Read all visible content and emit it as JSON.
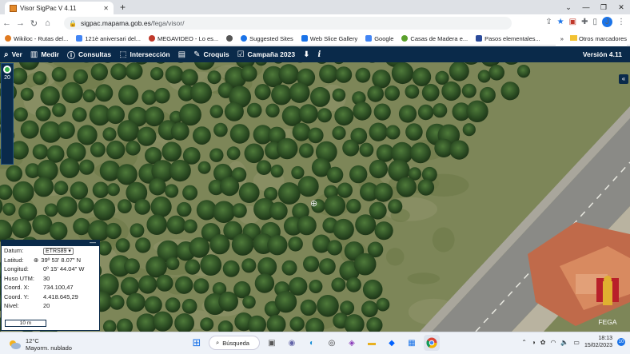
{
  "browser": {
    "tab_title": "Visor SigPac V 4.11",
    "tab_close": "✕",
    "new_tab": "+",
    "window_controls": [
      "⌄",
      "—",
      "❐",
      "✕"
    ],
    "url_host": "sigpac.mapama.gob.es",
    "url_path": "/fega/visor/",
    "avatar_letter": "J",
    "bookmarks": [
      {
        "label": "Wikiloc - Rutas del...",
        "color": "#e07a20"
      },
      {
        "label": "121è aniversari del...",
        "color": "#4285f4"
      },
      {
        "label": "MEGAVIDEO - Lo es...",
        "color": "#c0392b"
      },
      {
        "label": "",
        "color": "#555555"
      },
      {
        "label": "Suggested Sites",
        "color": "#1a73e8"
      },
      {
        "label": "Web Slice Gallery",
        "color": "#1a73e8"
      },
      {
        "label": "Google",
        "color": "#4285f4"
      },
      {
        "label": "Casas de Madera e...",
        "color": "#5aa02c"
      },
      {
        "label": "Pasos elementales...",
        "color": "#2a4a9a"
      }
    ],
    "bookmarks_more": "»",
    "other_bookmarks": "Otros marcadores"
  },
  "app_toolbar": {
    "tools": [
      {
        "icon": "search-icon",
        "glyph": "🔍",
        "label": "Ver"
      },
      {
        "icon": "ruler-icon",
        "glyph": "📏",
        "label": "Medir"
      },
      {
        "icon": "info-icon",
        "glyph": "ⓘ",
        "label": "Consultas"
      },
      {
        "icon": "intersection-icon",
        "glyph": "⬚",
        "label": "Intersección"
      },
      {
        "icon": "print-icon",
        "glyph": "🖶",
        "label": ""
      },
      {
        "icon": "pencil-icon",
        "glyph": "✎",
        "label": "Croquis"
      },
      {
        "icon": "calendar-icon",
        "glyph": "☑",
        "label": "Campaña 2023"
      },
      {
        "icon": "download-icon",
        "glyph": "⬇",
        "label": ""
      },
      {
        "icon": "about-icon",
        "glyph": "i",
        "label": ""
      }
    ],
    "version": "Versión 4.11"
  },
  "map": {
    "zoom_level": "20",
    "collapse_glyph": "«",
    "crosshair": "⊕",
    "logo_text": "FEGA"
  },
  "coordinates": {
    "datum_label": "Datum:",
    "datum_value": "ETRS89",
    "latitude_label": "Latitud:",
    "latitude_value": "39º 53' 8.07\" N",
    "longitude_label": "Longitud:",
    "longitude_value": "0º 15' 44.04\" W",
    "utm_label": "Huso UTM:",
    "utm_value": "30",
    "x_label": "Coord. X:",
    "x_value": "734.100,47",
    "y_label": "Coord. Y:",
    "y_value": "4.418.645,29",
    "level_label": "Nivel:",
    "level_value": "20",
    "scale": "10 m",
    "minimize": "—"
  },
  "taskbar": {
    "temperature": "12°C",
    "weather": "Mayorm. nublado",
    "search_label": "Búsqueda",
    "time": "18:13",
    "date": "15/02/2023",
    "notification_count": "10"
  }
}
